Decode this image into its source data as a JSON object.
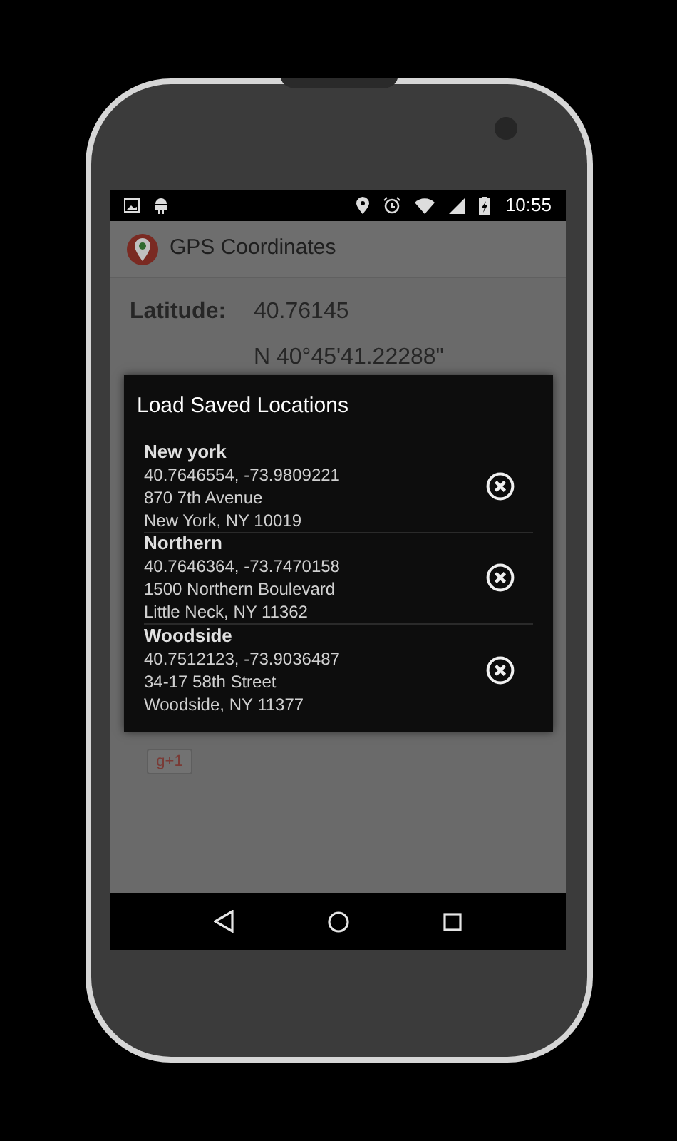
{
  "status_bar": {
    "time": "10:55"
  },
  "app_bar": {
    "title": "GPS Coordinates"
  },
  "latitude": {
    "label": "Latitude:",
    "decimal": "40.76145",
    "dms": "N 40°45'41.22288\""
  },
  "share_button": {
    "label": "g+1"
  },
  "dialog": {
    "title": "Load Saved Locations",
    "locations": [
      {
        "name": "New york",
        "coordinates": "40.7646554, -73.9809221",
        "street": "870 7th Avenue",
        "city": "New York, NY 10019"
      },
      {
        "name": "Northern",
        "coordinates": "40.7646364, -73.7470158",
        "street": "1500 Northern Boulevard",
        "city": "Little Neck, NY 11362"
      },
      {
        "name": "Woodside",
        "coordinates": "40.7512123, -73.9036487",
        "street": "34-17 58th Street",
        "city": "Woodside, NY 11377"
      }
    ]
  }
}
